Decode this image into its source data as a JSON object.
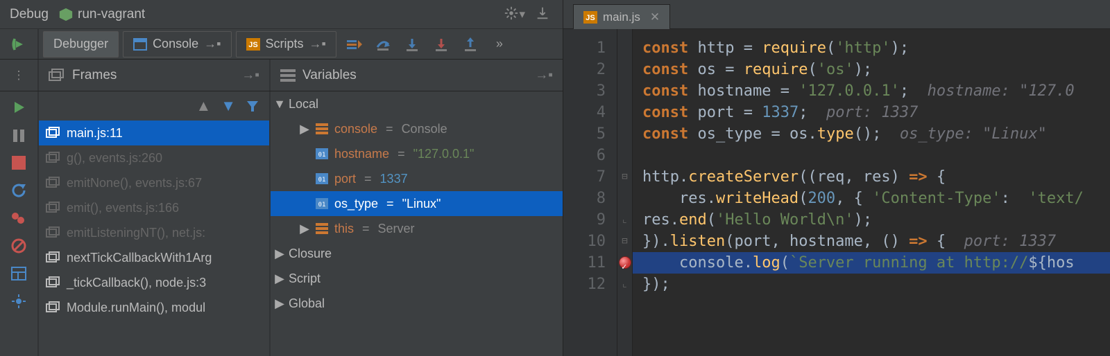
{
  "title": {
    "label": "Debug",
    "config": "run-vagrant"
  },
  "tabs": {
    "debugger": "Debugger",
    "console": "Console",
    "scripts": "Scripts"
  },
  "panes": {
    "frames": "Frames",
    "variables": "Variables"
  },
  "frames": [
    {
      "name": "main.js:11",
      "dim": false,
      "active": true
    },
    {
      "name": "g(), events.js:260",
      "dim": true
    },
    {
      "name": "emitNone(), events.js:67",
      "dim": true
    },
    {
      "name": "emit(), events.js:166",
      "dim": true
    },
    {
      "name": "emitListeningNT(), net.js:",
      "dim": true
    },
    {
      "name": "nextTickCallbackWith1Arg",
      "dim": false
    },
    {
      "name": "_tickCallback(), node.js:3",
      "dim": false
    },
    {
      "name": "Module.runMain(), modul",
      "dim": false
    }
  ],
  "variables": {
    "scopes": [
      "Local",
      "Closure",
      "Script",
      "Global"
    ],
    "local": [
      {
        "kind": "obj",
        "name": "console",
        "value": "Console",
        "vtype": "obj",
        "expand": true
      },
      {
        "kind": "prim",
        "name": "hostname",
        "value": "\"127.0.0.1\"",
        "vtype": "str"
      },
      {
        "kind": "prim",
        "name": "port",
        "value": "1337",
        "vtype": "num"
      },
      {
        "kind": "prim",
        "name": "os_type",
        "value": "\"Linux\"",
        "vtype": "str",
        "sel": true
      },
      {
        "kind": "obj",
        "name": "this",
        "value": "Server",
        "vtype": "obj",
        "expand": true
      }
    ]
  },
  "editor": {
    "filename": "main.js",
    "breakpoint_line": 11,
    "exec_line": 11,
    "lines": [
      1,
      2,
      3,
      4,
      5,
      6,
      7,
      8,
      9,
      10,
      11,
      12
    ],
    "code": [
      [
        [
          "kw",
          "const "
        ],
        [
          "id",
          "http "
        ],
        [
          "op",
          "= "
        ],
        [
          "fn",
          "require"
        ],
        [
          "op",
          "("
        ],
        [
          "str",
          "'http'"
        ],
        [
          "op",
          ");"
        ]
      ],
      [
        [
          "kw",
          "const "
        ],
        [
          "id",
          "os "
        ],
        [
          "op",
          "= "
        ],
        [
          "fn",
          "require"
        ],
        [
          "op",
          "("
        ],
        [
          "str",
          "'os'"
        ],
        [
          "op",
          ");"
        ]
      ],
      [
        [
          "kw",
          "const "
        ],
        [
          "id",
          "hostname "
        ],
        [
          "op",
          "= "
        ],
        [
          "str",
          "'127.0.0.1'"
        ],
        [
          "op",
          ";  "
        ],
        [
          "hint",
          "hostname: \"127.0"
        ]
      ],
      [
        [
          "kw",
          "const "
        ],
        [
          "id",
          "port "
        ],
        [
          "op",
          "= "
        ],
        [
          "num",
          "1337"
        ],
        [
          "op",
          ";  "
        ],
        [
          "hint",
          "port: 1337"
        ]
      ],
      [
        [
          "kw",
          "const "
        ],
        [
          "id",
          "os_type "
        ],
        [
          "op",
          "= "
        ],
        [
          "id",
          "os"
        ],
        [
          "op",
          "."
        ],
        [
          "fn",
          "type"
        ],
        [
          "op",
          "();  "
        ],
        [
          "hint",
          "os_type: \"Linux\""
        ]
      ],
      [],
      [
        [
          "id",
          "http"
        ],
        [
          "op",
          "."
        ],
        [
          "fn",
          "createServer"
        ],
        [
          "op",
          "((req, res) "
        ],
        [
          "kw",
          "=>"
        ],
        [
          "op",
          " {"
        ]
      ],
      [
        [
          "op",
          "    res."
        ],
        [
          "fn",
          "writeHead"
        ],
        [
          "op",
          "("
        ],
        [
          "num",
          "200"
        ],
        [
          "op",
          ", { "
        ],
        [
          "str",
          "'Content-Type'"
        ],
        [
          "op",
          ":  "
        ],
        [
          "str",
          "'text/"
        ]
      ],
      [
        [
          "op",
          "res."
        ],
        [
          "fn",
          "end"
        ],
        [
          "op",
          "("
        ],
        [
          "str",
          "'Hello World\\n'"
        ],
        [
          "op",
          ");"
        ]
      ],
      [
        [
          "op",
          "})."
        ],
        [
          "fn",
          "listen"
        ],
        [
          "op",
          "(port, hostname, () "
        ],
        [
          "kw",
          "=>"
        ],
        [
          "op",
          " {  "
        ],
        [
          "hint",
          "port: 1337"
        ]
      ],
      [
        [
          "op",
          "    console."
        ],
        [
          "fn",
          "log"
        ],
        [
          "op",
          "("
        ],
        [
          "str",
          "`Server running at http://"
        ],
        [
          "op",
          "${"
        ],
        [
          "id",
          "hos"
        ]
      ],
      [
        [
          "op",
          "});"
        ]
      ]
    ]
  }
}
